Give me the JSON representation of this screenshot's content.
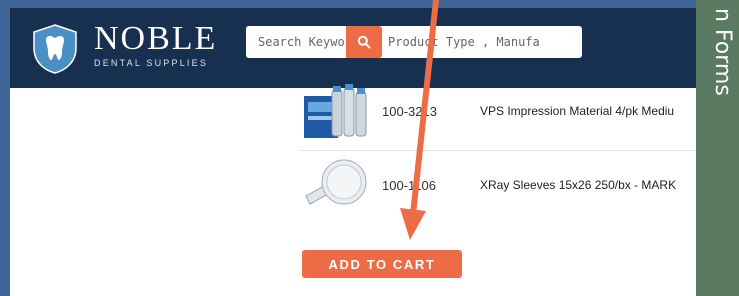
{
  "brand": {
    "name": "NOBLE",
    "tagline": "DENTAL SUPPLIES"
  },
  "search": {
    "placeholder": "Search Keywords , Product Type , Manufa"
  },
  "products": [
    {
      "sku": "100-3213",
      "description": "VPS Impression Material 4/pk Mediu"
    },
    {
      "sku": "100-1106",
      "description": "XRay Sleeves 15x26 250/bx - MARK"
    }
  ],
  "cart": {
    "button_label": "ADD TO CART"
  },
  "side_panel": {
    "label": "n Forms"
  },
  "colors": {
    "header": "#17304f",
    "accent": "#ee6c45",
    "frame": "#3f6697",
    "side_panel": "#5a7a62"
  }
}
